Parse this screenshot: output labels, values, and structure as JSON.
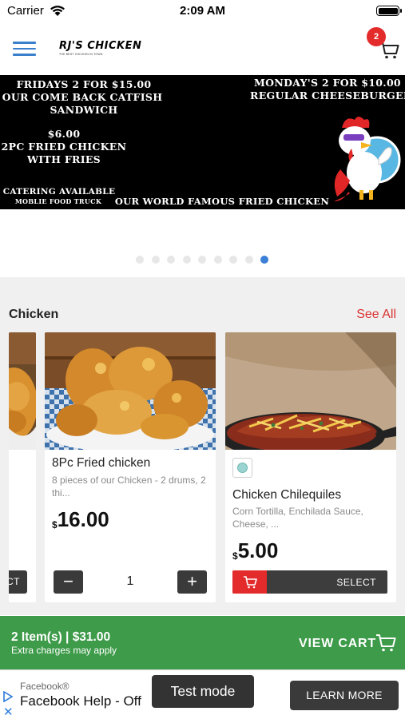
{
  "status_bar": {
    "carrier": "Carrier",
    "time": "2:09 AM"
  },
  "header": {
    "logo_text": "RJ'S CHICKEN",
    "logo_tagline": "THE BEST CHICKEN IN TOWN",
    "cart_count": "2"
  },
  "banner": {
    "line1": "Fridays 2 for $15.00",
    "line2": "Our Come Back Catfish",
    "line3": "Sandwich",
    "line4": "$6.00",
    "line5": "2pc Fried Chicken",
    "line6": "with Fries",
    "line7": "Catering Available",
    "line8": "Moblie Food Truck",
    "line9": "Our World Famous Fried Chicken",
    "line10": "Monday's 2 for $10.00",
    "line11": "Regular Cheeseburger"
  },
  "carousel": {
    "dot_count": 9,
    "active_index": 8
  },
  "section": {
    "title": "Chicken",
    "see_all": "See All"
  },
  "products": [
    {
      "partial_button": "CT"
    },
    {
      "title": "8Pc Fried chicken",
      "desc": "8 pieces of our Chicken - 2 drums, 2 thi...",
      "currency": "$",
      "price": "16.00",
      "quantity": "1",
      "minus": "−",
      "plus": "+"
    },
    {
      "title": "Chicken Chilequiles",
      "desc": "Corn Tortilla, Enchilada Sauce, Cheese, ...",
      "currency": "$",
      "price": "5.00",
      "select_label": "SELECT"
    }
  ],
  "cart_bar": {
    "summary": "2 Item(s) | $31.00",
    "note": "Extra charges may apply",
    "action": "VIEW CART"
  },
  "ad": {
    "advertiser": "Facebook®",
    "headline": "Facebook Help - Off",
    "test_mode": "Test mode",
    "cta": "LEARN MORE",
    "close": "✕"
  },
  "colors": {
    "accent_red": "#e32b2b",
    "accent_green": "#3e9b4a",
    "menu_blue": "#3a7fcc",
    "dot_active": "#3b7fd6"
  },
  "icons": [
    "wifi-icon",
    "battery-icon",
    "menu-icon",
    "cart-icon",
    "minus-icon",
    "plus-icon",
    "veg-icon",
    "ad-play-icon",
    "close-icon"
  ]
}
